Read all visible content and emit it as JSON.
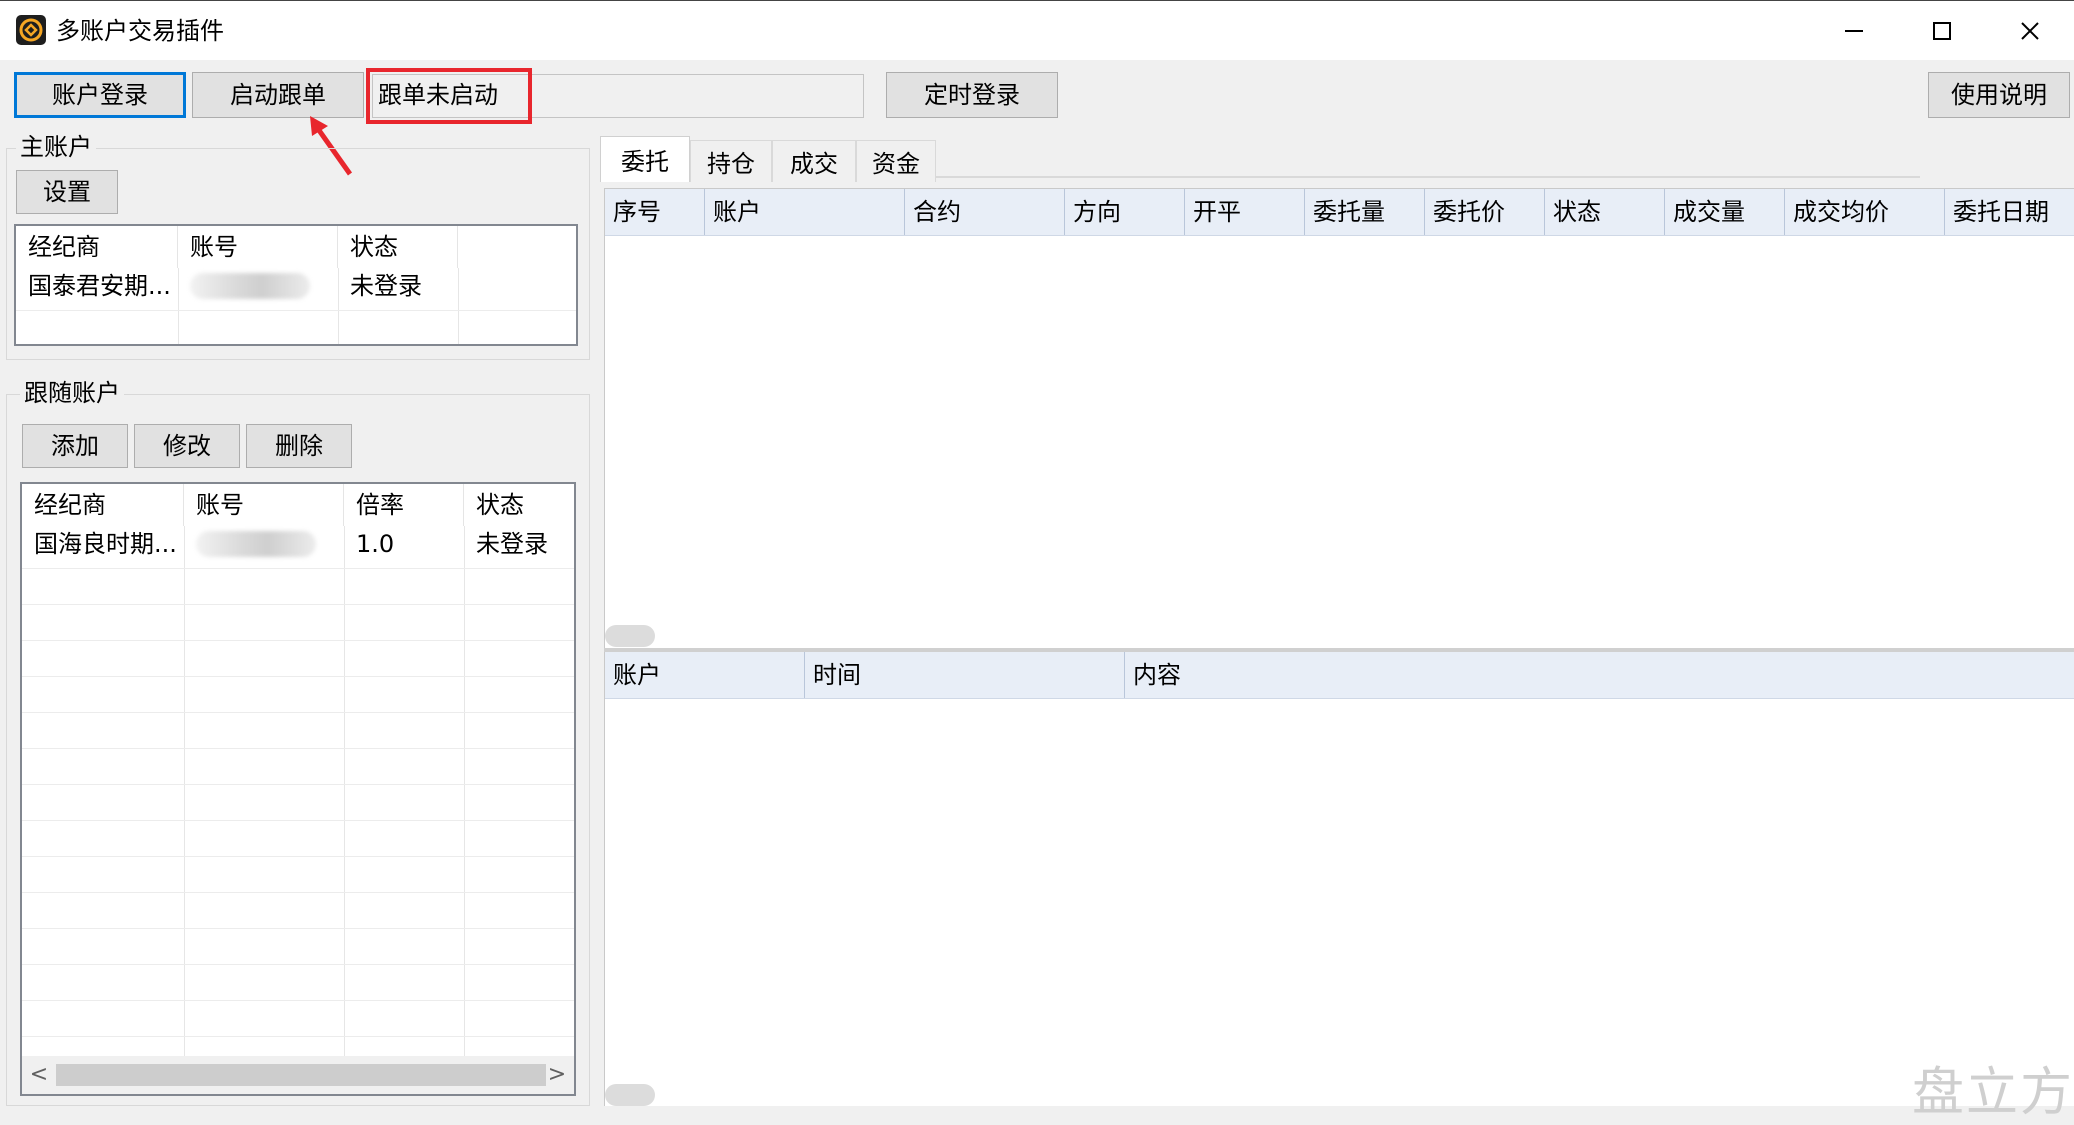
{
  "window": {
    "title": "多账户交易插件",
    "minimize_icon": "minimize-icon",
    "maximize_icon": "maximize-icon",
    "close_icon": "close-icon"
  },
  "toolbar": {
    "login_label": "账户登录",
    "start_follow_label": "启动跟单",
    "follow_status": "跟单未启动",
    "timed_login_label": "定时登录",
    "help_label": "使用说明"
  },
  "main_account": {
    "group_title": "主账户",
    "settings_label": "设置",
    "columns": [
      "经纪商",
      "账号",
      "状态"
    ],
    "rows": [
      {
        "broker": "国泰君安期...",
        "account": "",
        "status": "未登录"
      }
    ]
  },
  "follow_accounts": {
    "group_title": "跟随账户",
    "add_label": "添加",
    "edit_label": "修改",
    "delete_label": "删除",
    "columns": [
      "经纪商",
      "账号",
      "倍率",
      "状态"
    ],
    "rows": [
      {
        "broker": "国海良时期...",
        "account": "",
        "ratio": "1.0",
        "status": "未登录"
      }
    ],
    "scroll_left": "<",
    "scroll_right": ">"
  },
  "tabs": [
    {
      "label": "委托",
      "active": true
    },
    {
      "label": "持仓",
      "active": false
    },
    {
      "label": "成交",
      "active": false
    },
    {
      "label": "资金",
      "active": false
    }
  ],
  "orders_grid": {
    "columns": [
      "序号",
      "账户",
      "合约",
      "方向",
      "开平",
      "委托量",
      "委托价",
      "状态",
      "成交量",
      "成交均价",
      "委托日期"
    ]
  },
  "log_grid": {
    "columns": [
      "账户",
      "时间",
      "内容"
    ]
  },
  "watermark": "盘立方",
  "colors": {
    "focus_border": "#0078d7",
    "highlight_red": "#e8262d",
    "grid_header_bg": "#e8eef7",
    "window_bg": "#f0f0f0"
  }
}
